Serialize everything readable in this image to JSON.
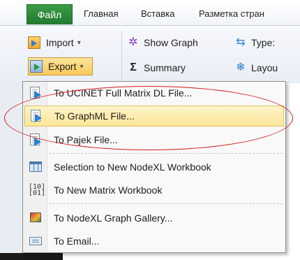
{
  "ribbon": {
    "file_tab": "Файл",
    "tabs": [
      "Главная",
      "Вставка",
      "Разметка стран"
    ],
    "buttons": {
      "import": "Import",
      "export": "Export",
      "show_graph": "Show Graph",
      "type": "Type:",
      "summary": "Summary",
      "layout": "Layou"
    },
    "dropdown_glyph": "▾"
  },
  "export_menu": {
    "items": [
      {
        "label": "To UCINET Full Matrix DL File...",
        "icon": "document-arrow-icon"
      },
      {
        "label": "To GraphML File...",
        "icon": "document-arrow-icon",
        "highlighted": true
      },
      {
        "label": "To Pajek File...",
        "icon": "document-arrow-icon"
      },
      {
        "label": "Selection to New NodeXL Workbook",
        "icon": "workbook-grid-icon"
      },
      {
        "label": "To New Matrix Workbook",
        "icon": "matrix-icon"
      },
      {
        "label": "To NodeXL Graph Gallery...",
        "icon": "gallery-icon"
      },
      {
        "label": "To Email...",
        "icon": "email-icon"
      }
    ]
  },
  "colors": {
    "file_tab": "#2a8a38",
    "highlight": "#fde69a",
    "annotation": "#d21b1b"
  }
}
